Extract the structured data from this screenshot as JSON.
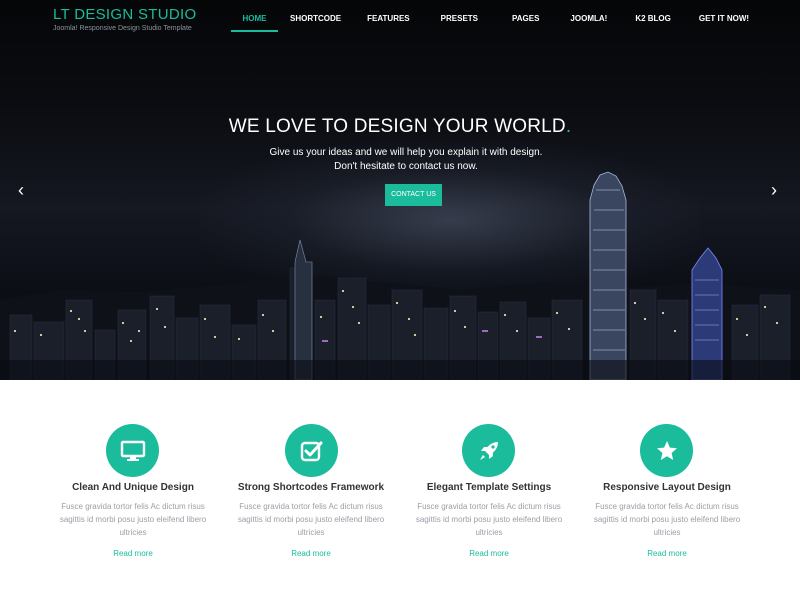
{
  "brand": {
    "title": "LT DESIGN STUDIO",
    "tagline": "Joomla! Responsive Design Studio Template"
  },
  "nav": {
    "items": [
      "HOME",
      "SHORTCODE",
      "FEATURES",
      "PRESETS",
      "PAGES",
      "JOOMLA!",
      "K2 BLOG",
      "GET IT NOW!"
    ],
    "active_index": 0
  },
  "hero": {
    "title": "WE LOVE TO DESIGN YOUR WORLD",
    "title_dot": ".",
    "subtitle_line1": "Give us your ideas and we will help you explain it with design.",
    "subtitle_line2": "Don't hesitate to contact us now.",
    "cta_label": "CONTACT US",
    "prev_icon": "chevron-left-icon",
    "next_icon": "chevron-right-icon",
    "prev_glyph": "‹",
    "next_glyph": "›"
  },
  "features": [
    {
      "icon": "monitor-icon",
      "title": "Clean And Unique Design",
      "text": "Fusce gravida tortor felis Ac dictum risus sagittis id morbi posu justo eleifend libero ultricies",
      "link": "Read more"
    },
    {
      "icon": "checkbox-icon",
      "title": "Strong Shortcodes Framework",
      "text": "Fusce gravida tortor felis Ac dictum risus sagittis id morbi posu justo eleifend libero ultricies",
      "link": "Read more"
    },
    {
      "icon": "rocket-icon",
      "title": "Elegant Template Settings",
      "text": "Fusce gravida tortor felis Ac dictum risus sagittis id morbi posu justo eleifend libero ultricies",
      "link": "Read more"
    },
    {
      "icon": "star-icon",
      "title": "Responsive Layout Design",
      "text": "Fusce gravida tortor felis Ac dictum risus sagittis id morbi posu justo eleifend libero ultricies",
      "link": "Read more"
    }
  ],
  "colors": {
    "accent": "#1abc9c",
    "nav_text": "#ffffff",
    "feature_title": "#333333",
    "feature_text": "#9aa0a6"
  }
}
